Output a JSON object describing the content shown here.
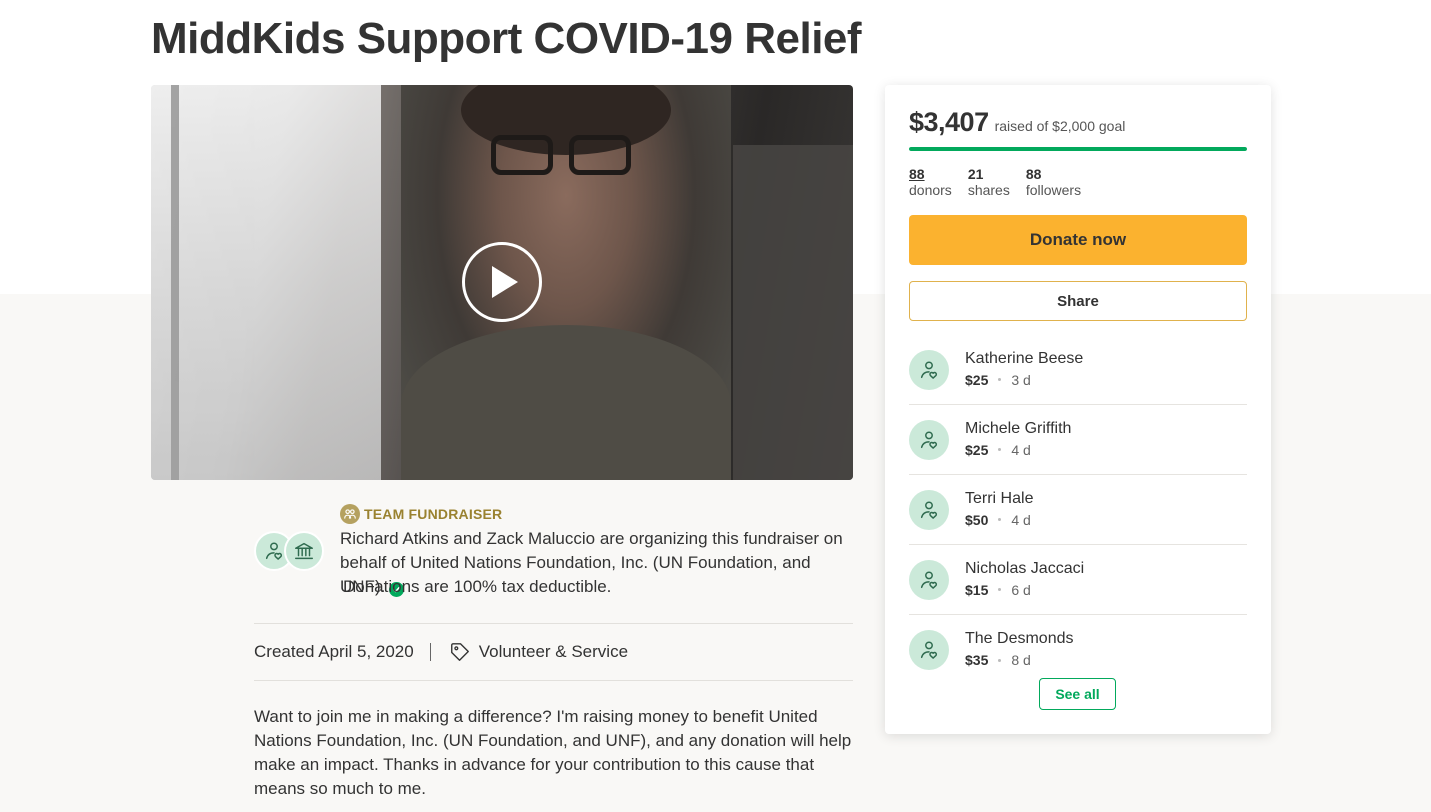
{
  "campaign": {
    "title": "MiddKids Support COVID-19 Relief"
  },
  "organizer": {
    "team_label": "TEAM FUNDRAISER",
    "text": "Richard Atkins and Zack Maluccio are organizing this fundraiser on behalf of United Nations Foundation, Inc. (UN Foundation, and UNF).",
    "tax_note": "Donations are 100% tax deductible."
  },
  "meta": {
    "created": "Created April 5, 2020",
    "category": "Volunteer & Service"
  },
  "story": {
    "text": "Want to join me in making a difference? I'm raising money to benefit United Nations Foundation, Inc. (UN Foundation, and UNF), and any donation will help make an impact. Thanks in advance for your contribution to this cause that means so much to me."
  },
  "progress": {
    "raised": "$3,407",
    "goal_text": "raised of $2,000 goal",
    "fraction": 1.0
  },
  "stats": {
    "donors_count": "88",
    "donors_label": "donors",
    "shares_count": "21",
    "shares_label": "shares",
    "followers_count": "88",
    "followers_label": "followers"
  },
  "buttons": {
    "donate": "Donate now",
    "share": "Share",
    "see_all": "See all"
  },
  "donors": [
    {
      "name": "Katherine Beese",
      "amount": "$25",
      "time": "3 d"
    },
    {
      "name": "Michele Griffith",
      "amount": "$25",
      "time": "4 d"
    },
    {
      "name": "Terri Hale",
      "amount": "$50",
      "time": "4 d"
    },
    {
      "name": "Nicholas Jaccaci",
      "amount": "$15",
      "time": "6 d"
    },
    {
      "name": "The Desmonds",
      "amount": "$35",
      "time": "8 d"
    }
  ],
  "colors": {
    "brand_green": "#02a95c",
    "donate_yellow": "#fbb22f",
    "avatar_bg": "#cbe9d9",
    "team_gold": "#9a8230"
  },
  "icons": {
    "play": "play-icon",
    "verified": "verified-check-icon",
    "tag": "tag-icon",
    "team": "team-icon",
    "donor": "heart-hand-icon",
    "charity": "charity-building-icon"
  }
}
